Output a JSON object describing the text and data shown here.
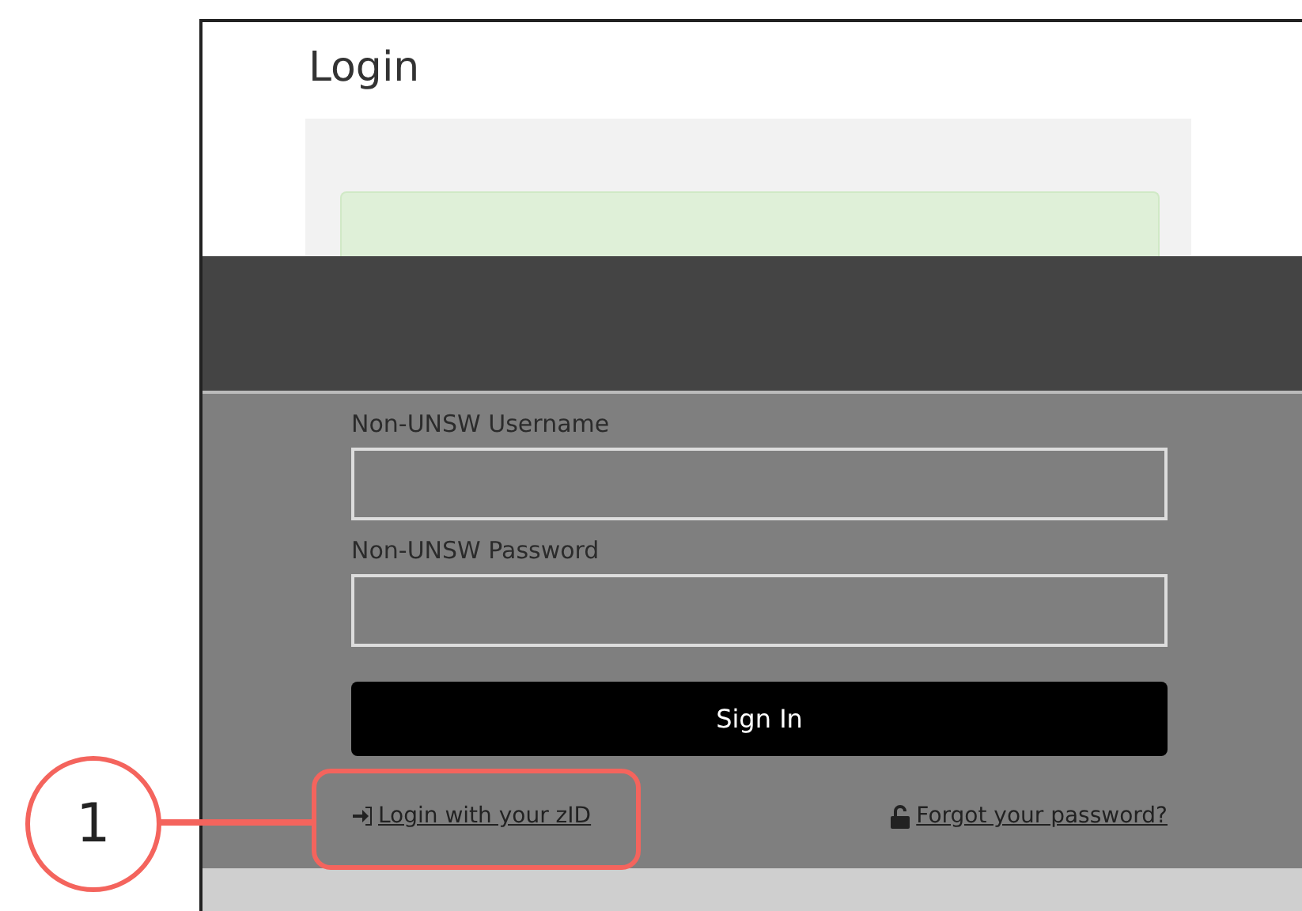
{
  "page": {
    "title": "Login"
  },
  "form": {
    "fields": [
      {
        "label": "Non-UNSW Username"
      },
      {
        "label": "Non-UNSW Password"
      }
    ],
    "submit": "Sign In",
    "links": [
      {
        "label": "Login with your zID",
        "kind": "login"
      },
      {
        "label": "Forgot your password?",
        "kind": "unlock"
      }
    ]
  },
  "callout": {
    "number": "1"
  }
}
